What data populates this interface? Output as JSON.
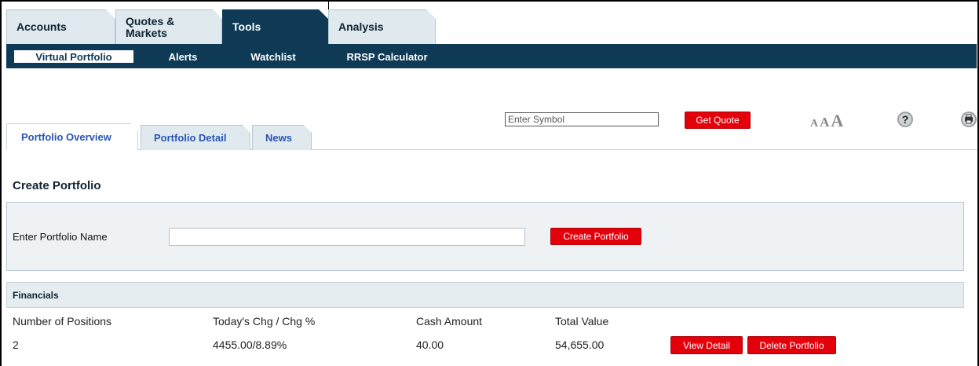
{
  "top_tabs": [
    {
      "label": "Accounts",
      "active": false
    },
    {
      "label": "Quotes & Markets",
      "active": false
    },
    {
      "label": "Tools",
      "active": true
    },
    {
      "label": "Analysis",
      "active": false
    }
  ],
  "sub_nav": [
    {
      "label": "Virtual Portfolio",
      "active": true
    },
    {
      "label": "Alerts",
      "active": false
    },
    {
      "label": "Watchlist",
      "active": false
    },
    {
      "label": "RRSP Calculator",
      "active": false
    }
  ],
  "quote": {
    "symbol_placeholder": "Enter Symbol",
    "button_label": "Get Quote"
  },
  "tools": {
    "font_size_labels": [
      "A",
      "A",
      "A"
    ],
    "help_icon": "question-circle-icon",
    "print_icon": "print-icon"
  },
  "content_tabs": [
    {
      "label": "Portfolio Overview",
      "active": true
    },
    {
      "label": "Portfolio Detail",
      "active": false
    },
    {
      "label": "News",
      "active": false
    }
  ],
  "create_portfolio": {
    "title": "Create Portfolio",
    "name_label": "Enter Portfolio Name",
    "name_value": "",
    "button_label": "Create Portfolio"
  },
  "financials": {
    "header": "Financials",
    "columns": [
      "Number of Positions",
      "Today's Chg / Chg %",
      "Cash Amount",
      "Total Value"
    ],
    "row": {
      "positions": "2",
      "change": "4455.00/8.89%",
      "cash": "40.00",
      "total": "54,655.00"
    },
    "view_detail_label": "View Detail",
    "delete_label": "Delete Portfolio"
  },
  "colors": {
    "navy": "#0e3a55",
    "tab_bg": "#dfe9ee",
    "action_red": "#e4000b",
    "link_blue": "#2a55b5"
  }
}
